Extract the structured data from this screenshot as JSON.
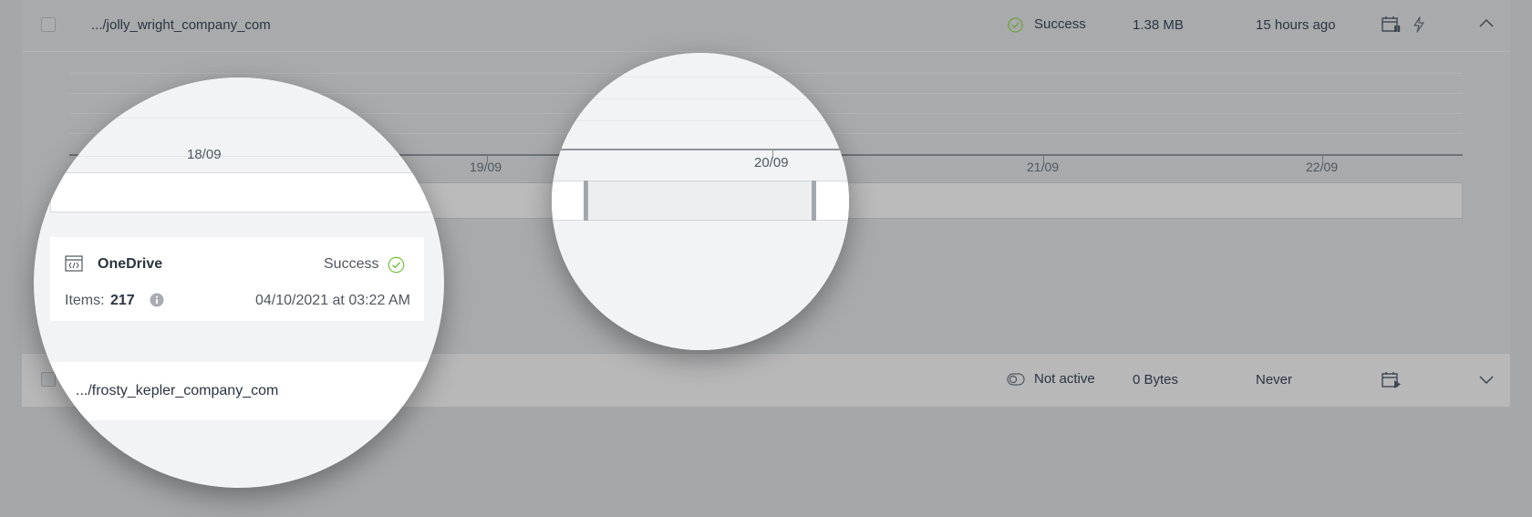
{
  "rows": [
    {
      "path": ".../jolly_wright_company_com",
      "status": "Success",
      "size": "1.38 MB",
      "last_backup": "15 hours ago",
      "expanded": true
    },
    {
      "path": ".../frosty_kepler_company_com",
      "status": "Not active",
      "size": "0 Bytes",
      "last_backup": "Never",
      "expanded": false
    }
  ],
  "timeline": {
    "ticks": [
      "18/09",
      "19/09",
      "20/09",
      "21/09",
      "22/09"
    ]
  },
  "detail_card": {
    "service": "OneDrive",
    "status": "Success",
    "items_label": "Items:",
    "items_count": "217",
    "timestamp": "04/10/2021 at 03:22 AM"
  },
  "colors": {
    "success": "#7fc24a",
    "overlay": "#a6a7a9",
    "text": "#2b3440"
  },
  "icons": [
    "checkbox-icon",
    "success-check-icon",
    "calendar-pause-icon",
    "lightning-icon",
    "chevron-up-icon",
    "toggle-off-icon",
    "calendar-play-icon",
    "chevron-down-icon",
    "code-window-icon",
    "info-icon"
  ]
}
